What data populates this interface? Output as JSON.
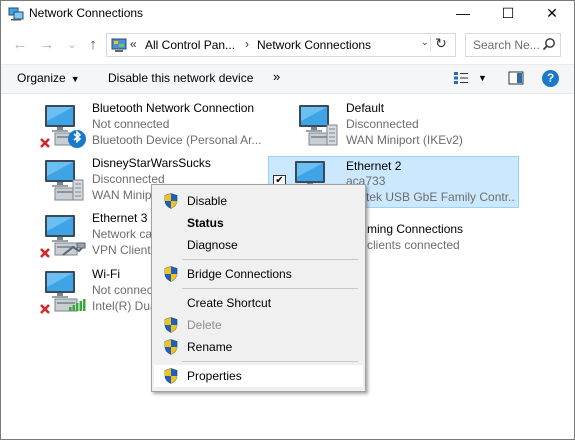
{
  "window": {
    "title": "Network Connections",
    "minimize": "—",
    "maximize": "☐",
    "close": "✕"
  },
  "nav": {
    "back": "←",
    "forward": "→",
    "recent": "⌄",
    "up": "↑"
  },
  "address": {
    "overflow": "«",
    "crumbs": [
      "All Control Pan...",
      "Network Connections"
    ],
    "separator": "›",
    "dropdown": "⌄",
    "refresh": "↻"
  },
  "search": {
    "placeholder": "Search Ne..."
  },
  "commands": {
    "organize": "Organize",
    "organize_caret": "▼",
    "disable": "Disable this network device",
    "more": "»",
    "view_caret": "▼",
    "help": "?"
  },
  "connections": [
    {
      "name": "Bluetooth Network Connection",
      "status": "Not connected",
      "device": "Bluetooth Device (Personal Ar...",
      "badge": "bluetooth",
      "error": true
    },
    {
      "name": "Default",
      "status": "Disconnected",
      "device": "WAN Miniport (IKEv2)",
      "badge": "server",
      "error": false
    },
    {
      "name": "DisneyStarWarsSucks",
      "status": "Disconnected",
      "device": "WAN Minip",
      "badge": "server",
      "error": false
    },
    {
      "name": "Ethernet 2",
      "status": "aca733",
      "device": "tek USB GbE Family Contr...",
      "badge": "ethernet",
      "error": false,
      "selected": true,
      "checked": "✔"
    },
    {
      "name": "Ethernet 3",
      "status": "Network ca",
      "device": "VPN Client",
      "badge": "cable",
      "error": true
    },
    {
      "name": "ming Connections",
      "status": "clients connected",
      "device": "",
      "badge": "none",
      "error": false
    },
    {
      "name": "Wi-Fi",
      "status": "Not connec",
      "device": "Intel(R) Dua",
      "badge": "wifi-bars",
      "error": true
    }
  ],
  "context_menu": {
    "items": [
      {
        "label": "Disable",
        "shield": true,
        "style": "normal"
      },
      {
        "label": "Status",
        "shield": false,
        "style": "bold"
      },
      {
        "label": "Diagnose",
        "shield": false,
        "style": "normal"
      },
      {
        "label": "Bridge Connections",
        "shield": true,
        "style": "normal"
      },
      {
        "label": "Create Shortcut",
        "shield": false,
        "style": "normal"
      },
      {
        "label": "Delete",
        "shield": true,
        "style": "disabled"
      },
      {
        "label": "Rename",
        "shield": true,
        "style": "normal"
      },
      {
        "label": "Properties",
        "shield": true,
        "style": "hover"
      }
    ]
  },
  "colors": {
    "selection_bg": "#cce8ff",
    "selection_border": "#99d1ff",
    "help_blue": "#1979ca",
    "error_red": "#d9252a",
    "wifi_green": "#3aa83a"
  }
}
